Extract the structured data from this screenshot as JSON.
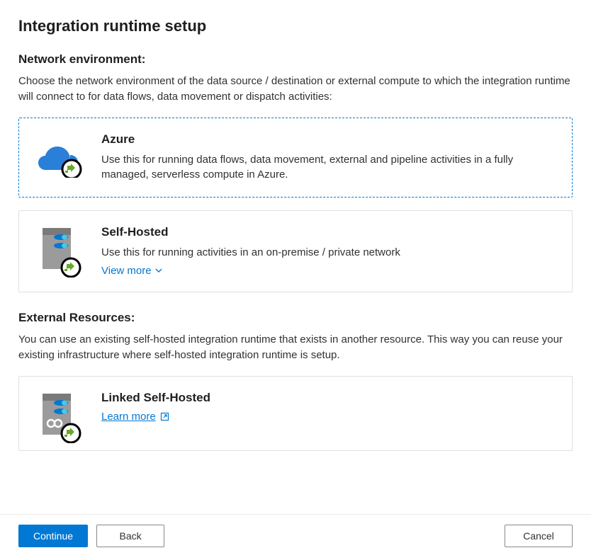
{
  "page_title": "Integration runtime setup",
  "network": {
    "label": "Network environment:",
    "desc": "Choose the network environment of the data source / destination or external compute to which the integration runtime will connect to for data flows, data movement or dispatch activities:"
  },
  "cards": {
    "azure": {
      "title": "Azure",
      "desc": "Use this for running data flows, data movement, external and pipeline activities in a fully managed, serverless compute in Azure."
    },
    "self_hosted": {
      "title": "Self-Hosted",
      "desc": "Use this for running activities in an on-premise / private network",
      "view_more": "View more"
    },
    "linked": {
      "title": "Linked Self-Hosted",
      "learn_more": "Learn more"
    }
  },
  "external": {
    "label": "External Resources:",
    "desc": "You can use an existing self-hosted integration runtime that exists in another resource. This way you can reuse your existing infrastructure where self-hosted integration runtime is setup."
  },
  "buttons": {
    "continue": "Continue",
    "back": "Back",
    "cancel": "Cancel"
  }
}
